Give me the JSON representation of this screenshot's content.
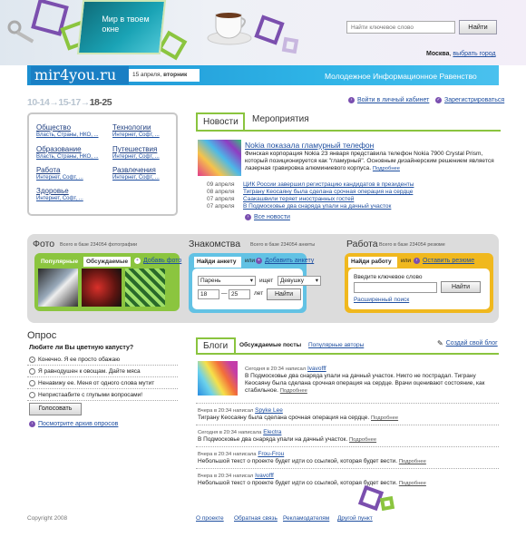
{
  "header": {
    "teaser": "Мир в твоем окне",
    "search_placeholder": "Найти ключевое слово",
    "search_button": "Найти",
    "city": "Москва",
    "change_city": "выбрать город"
  },
  "brand": {
    "logo": "mir4you.ru",
    "date": "15 апреля,",
    "weekday": "вторник",
    "slogan": "Молодежное Информационное Равенство"
  },
  "ages": {
    "a": "10-14",
    "b": "15-17",
    "c": "18-25",
    "arrow": "→"
  },
  "account": {
    "login": "Войти в личный кабинет",
    "register": "Зарегистрироваться"
  },
  "categories": [
    {
      "title": "Общество",
      "sub": "Власть, Страны, НКО, ..."
    },
    {
      "title": "Технологии",
      "sub": "Интернет, Софт, ..."
    },
    {
      "title": "Образование",
      "sub": "Власть, Страны, НКО, ..."
    },
    {
      "title": "Путешествия",
      "sub": "Интернет, Софт, ..."
    },
    {
      "title": "Работа",
      "sub": "Интернет, Софт, ..."
    },
    {
      "title": "Развлечения",
      "sub": "Интернет, Софт, ..."
    },
    {
      "title": "Здоровье",
      "sub": "Интернет, Софт, ..."
    }
  ],
  "news": {
    "tab_active": "Новости",
    "tab_other": "Мероприятия",
    "title": "Nokia показала гламурный телефон",
    "body": "Финская корпорация Nokia 23 января представила телефон Nokia 7900 Crystal Prism, который позиционируется как \"гламурный\". Основным дизайнерским решением является лазерная гравировка алюминиевого корпуса.",
    "more": "Подробнее",
    "items": [
      {
        "date": "09 апреля",
        "text": "ЦИК России завершил регистрацию кандидатов в президенты"
      },
      {
        "date": "08 апреля",
        "text": "Тиграну Кеосаяну была сделана срочная операция на сердце"
      },
      {
        "date": "07 апреля",
        "text": "Саакашвили теряет иностранных гостей"
      },
      {
        "date": "07 апреля",
        "text": "В Подмосковье два снаряда упали на дачный участок"
      }
    ],
    "all": "Все новости"
  },
  "photo": {
    "title": "Фото",
    "count": "Всего в базе 234054 фотографии",
    "tab_popular": "Популярные",
    "tab_discussed": "Обсуждаемые",
    "add": "Добавь фото"
  },
  "meet": {
    "title": "Знакомства",
    "count": "Всего в базе 234054 анкеты",
    "tab": "Найди анкету",
    "or": "или",
    "add": "Добавить анкету",
    "gender_me": "Парень",
    "seeks": "ищет",
    "gender_them": "Девушку",
    "age_from": "18",
    "dash": "—",
    "age_to": "25",
    "years": "лет",
    "button": "Найти"
  },
  "job": {
    "title": "Работа",
    "count": "Всего в базе 234054 резюме",
    "tab": "Найди работу",
    "or": "или",
    "add": "Оставить резюме",
    "label": "Введите ключевое слово",
    "button": "Найти",
    "advanced": "Расширенный поиск"
  },
  "poll": {
    "title": "Опрос",
    "question": "Любите ли Вы цветную капусту?",
    "options": [
      "Конечно. Я ее просто обажаю",
      "Я равнодушен к овощам. Дайте мяса",
      "Ненавижу ее. Меня от одного слова мутит",
      "Непристаабите с глупыми вопросами!"
    ],
    "vote": "Голосовать",
    "archive": "Посмотрите архив опросов"
  },
  "blogs": {
    "tab": "Блоги",
    "discussed": "Обсуждаемые посты",
    "popular": "Популярные авторы",
    "create": "Создай свой блог",
    "more": "Подробнее",
    "wrote": "написала",
    "wrote_m": "написал",
    "posts": [
      {
        "when": "Сегодня в 20:34",
        "verb": "написал",
        "author": "Ivavofff",
        "text": "В Подмосковье два снаряда упали на дачный участок. Никто не пострадал. Тиграну Кеосаяну была сделана срочная операция на сердце. Врачи оценивают состояние, как стабильное."
      },
      {
        "when": "Вчера в 20:34",
        "verb": "написал",
        "author": "Spyke Lee",
        "text": "Тиграну Кеосаяну была сделана срочная операция на сердце."
      },
      {
        "when": "Сегодня в 20:34",
        "verb": "написала",
        "author": "Electra",
        "text": "В Подмосковье два снаряда упали на дачный участок."
      },
      {
        "when": "Вчера в 20:34",
        "verb": "написала",
        "author": "Frou-Frou",
        "text": "Небольшой текст о проекте будет идти со ссылкой, которая будет вести."
      },
      {
        "when": "Вчера в 20:34",
        "verb": "написал",
        "author": "Ivavofff",
        "text": "Небольшой текст о проекте будет идти со ссылкой, которая будет вести."
      }
    ]
  },
  "footer": {
    "copyright": "Copyright 2008",
    "links": [
      "О проекте",
      "Обратная связь",
      "Рекламодателям",
      "Другой пункт"
    ]
  }
}
